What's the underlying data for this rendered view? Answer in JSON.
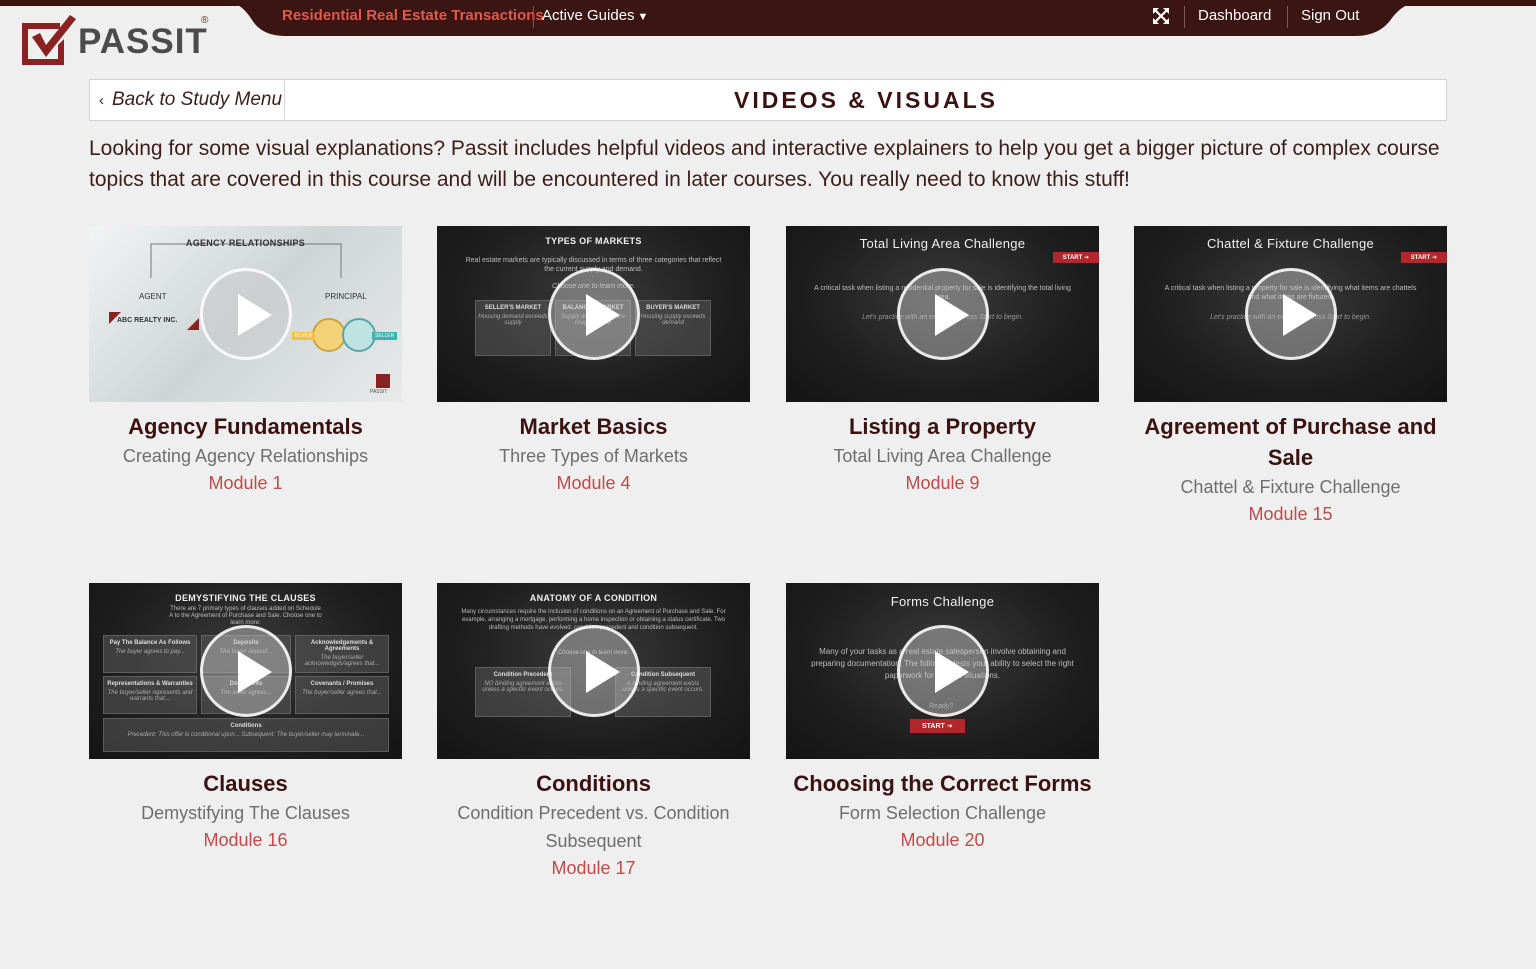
{
  "topnav": {
    "course": "Residential Real Estate Transactions",
    "guides": "Active Guides",
    "dashboard": "Dashboard",
    "signout": "Sign Out"
  },
  "logo": {
    "text": "PASSIT",
    "reg": "®"
  },
  "header": {
    "back": "Back to Study Menu",
    "title": "VIDEOS & VISUALS"
  },
  "intro": "Looking for some visual explanations? Passit includes helpful videos and interactive explainers to help you get a bigger picture of complex course topics that are covered in this course and will be encountered in later courses. You really need to know this stuff!",
  "cards": [
    {
      "title": "Agency Fundamentals",
      "subtitle": "Creating Agency Relationships",
      "module": "Module 1",
      "thumb": {
        "heading": "AGENCY RELATIONSHIPS",
        "agent": "AGENT",
        "principal": "PRINCIPAL",
        "company": "ABC REALTY INC.",
        "buyer": "BUYER",
        "seller": "SELLER",
        "brand": "PASSIT"
      }
    },
    {
      "title": "Market Basics",
      "subtitle": "Three Types of Markets",
      "module": "Module 4",
      "thumb": {
        "heading": "TYPES OF MARKETS",
        "body": "Real estate markets are typically discussed in terms of three categories that reflect the current supply and demand.",
        "prompt": "Choose one to learn more.",
        "tiles": [
          {
            "label": "SELLER'S MARKET",
            "note": "Housing demand exceeds supply"
          },
          {
            "label": "BALANCED MARKET",
            "note": "Supply and demand are roughly equal"
          },
          {
            "label": "BUYER'S MARKET",
            "note": "Housing supply exceeds demand"
          }
        ]
      }
    },
    {
      "title": "Listing a Property",
      "subtitle": "Total Living Area Challenge",
      "module": "Module 9",
      "thumb": {
        "heading": "Total Living Area Challenge",
        "start": "START ➔",
        "body": "A critical task when listing a residential property for sale is identifying the total living area.",
        "note": "Let's practice with an example. Press Start to begin."
      }
    },
    {
      "title": "Agreement of Purchase and Sale",
      "subtitle": "Chattel & Fixture Challenge",
      "module": "Module 15",
      "thumb": {
        "heading": "Chattel & Fixture Challenge",
        "start": "START ➔",
        "body": "A critical task when listing a property for sale is identifying what items are chattels and what items are fixtures.",
        "note": "Let's practice with an example. Press Start to begin."
      }
    },
    {
      "title": "Clauses",
      "subtitle": "Demystifying The Clauses",
      "module": "Module 16",
      "thumb": {
        "heading": "DEMYSTIFYING THE CLAUSES",
        "body": "There are 7 primary types of clauses added on Schedule A to the Agreement of Purchase and Sale. Choose one to learn more:",
        "tiles": [
          {
            "label": "Pay The Balance As Follows",
            "note": "The buyer agrees to pay..."
          },
          {
            "label": "Deposits",
            "note": "The buyer deposit..."
          },
          {
            "label": "Acknowledgements & Agreements",
            "note": "The buyer/seller acknowledges/agrees that..."
          },
          {
            "label": "Representations & Warranties",
            "note": "The buyer/seller represents and warrants that..."
          },
          {
            "label": "Documents",
            "note": "The seller agrees..."
          },
          {
            "label": "Covenants / Promises",
            "note": "The buyer/seller agrees that..."
          },
          {
            "label": "Conditions",
            "note": "Precedent: This offer is conditional upon... Subsequent: The buyer/seller may terminate..."
          }
        ]
      }
    },
    {
      "title": "Conditions",
      "subtitle": "Condition Precedent vs. Condition Subsequent",
      "module": "Module 17",
      "thumb": {
        "heading": "ANATOMY OF A CONDITION",
        "body": "Many circumstances require the inclusion of conditions on an Agreement of Purchase and Sale. For example, arranging a mortgage, performing a home inspection or obtaining a status certificate. Two drafting methods have evolved: condition precedent and condition subsequent.",
        "prompt": "Choose one to learn more.",
        "tiles": [
          {
            "label": "Condition Precedent",
            "note": "NO binding agreement exists unless a specific event occurs."
          },
          {
            "label": "Condition Subsequent",
            "note": "A binding agreement exists unless a specific event occurs."
          }
        ]
      }
    },
    {
      "title": "Choosing the Correct Forms",
      "subtitle": "Form Selection Challenge",
      "module": "Module 20",
      "thumb": {
        "heading": "Forms Challenge",
        "body": "Many of your tasks as a real estate salesperson involve obtaining and preparing documentation. The following tests your ability to select the right paperwork for various situations.",
        "ready": "Ready?",
        "start": "START ➔"
      }
    }
  ]
}
